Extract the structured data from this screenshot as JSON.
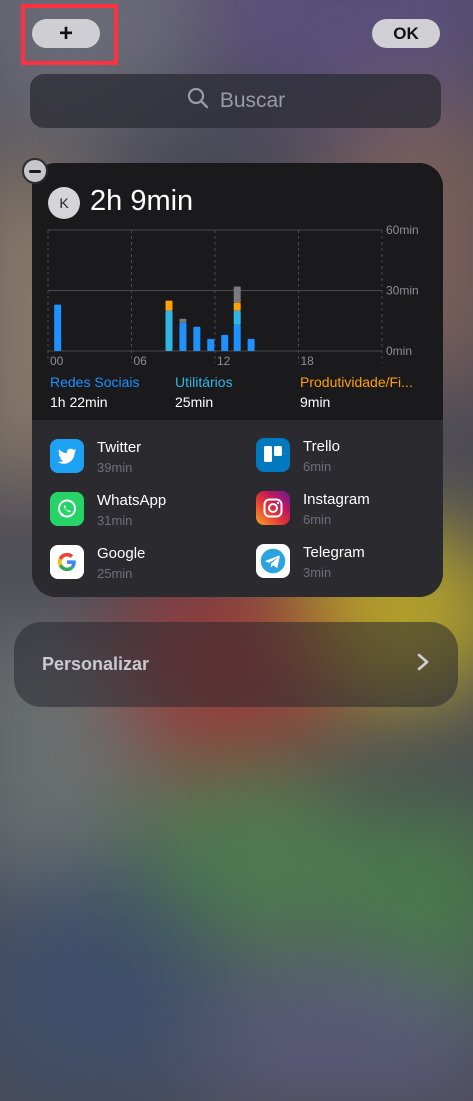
{
  "header": {
    "add_label": "+",
    "ok_label": "OK"
  },
  "search": {
    "placeholder": "Buscar",
    "icon": "search-icon"
  },
  "widget": {
    "avatar_letter": "K",
    "total_time": "2h 9min",
    "colors": {
      "social": "#1e90ff",
      "utilities": "#31b4e6",
      "productivity": "#ff9f0a",
      "other": "#7a7a80"
    },
    "chart_data": {
      "type": "bar",
      "stacked": true,
      "x_ticks": [
        "00",
        "06",
        "12",
        "18"
      ],
      "y_ticks": [
        "60min",
        "30min",
        "0min"
      ],
      "ylim": [
        0,
        60
      ],
      "bars": [
        {
          "hour": 0.3,
          "social": 23,
          "utilities": 0,
          "productivity": 0,
          "other": 0
        },
        {
          "hour": 8.3,
          "social": 0,
          "utilities": 20,
          "productivity": 5,
          "other": 0
        },
        {
          "hour": 9.3,
          "social": 14,
          "utilities": 0,
          "productivity": 0,
          "other": 2
        },
        {
          "hour": 10.3,
          "social": 12,
          "utilities": 0,
          "productivity": 0,
          "other": 0
        },
        {
          "hour": 11.3,
          "social": 6,
          "utilities": 0,
          "productivity": 0,
          "other": 0
        },
        {
          "hour": 12.3,
          "social": 8,
          "utilities": 0,
          "productivity": 0,
          "other": 0
        },
        {
          "hour": 13.2,
          "social": 13,
          "utilities": 7,
          "productivity": 4,
          "other": 8
        },
        {
          "hour": 14.2,
          "social": 6,
          "utilities": 0,
          "productivity": 0,
          "other": 0
        }
      ]
    },
    "categories": [
      {
        "name": "Redes Sociais",
        "time": "1h 22min",
        "color": "#1e90ff"
      },
      {
        "name": "Utilitários",
        "time": "25min",
        "color": "#31b4e6"
      },
      {
        "name": "Produtividade/Fi...",
        "time": "9min",
        "color": "#ff9f0a"
      }
    ],
    "apps": [
      {
        "name": "Twitter",
        "time": "39min",
        "icon": "twitter-icon"
      },
      {
        "name": "Trello",
        "time": "6min",
        "icon": "trello-icon"
      },
      {
        "name": "WhatsApp",
        "time": "31min",
        "icon": "whatsapp-icon"
      },
      {
        "name": "Instagram",
        "time": "6min",
        "icon": "instagram-icon"
      },
      {
        "name": "Google",
        "time": "25min",
        "icon": "google-icon"
      },
      {
        "name": "Telegram",
        "time": "3min",
        "icon": "telegram-icon"
      }
    ]
  },
  "customize": {
    "label": "Personalizar",
    "chevron": "chevron-right-icon"
  }
}
